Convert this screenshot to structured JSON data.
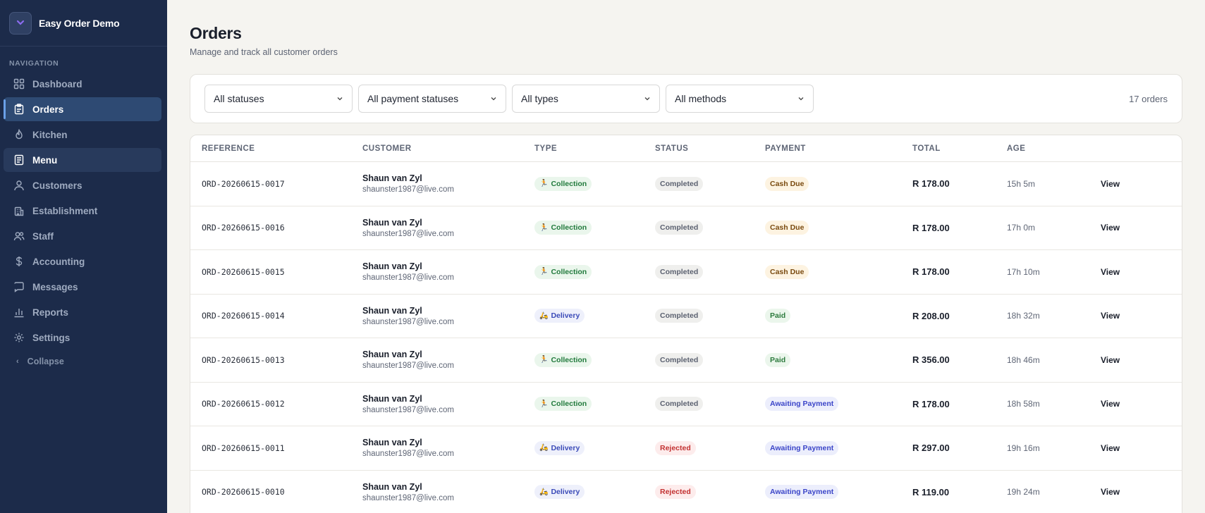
{
  "app": {
    "name": "Easy Order Demo"
  },
  "sidebar": {
    "heading": "NAVIGATION",
    "items": [
      {
        "label": "Dashboard",
        "icon": "dashboard-icon"
      },
      {
        "label": "Orders",
        "icon": "clipboard-icon"
      },
      {
        "label": "Kitchen",
        "icon": "flame-icon"
      },
      {
        "label": "Menu",
        "icon": "book-icon"
      },
      {
        "label": "Customers",
        "icon": "user-icon"
      },
      {
        "label": "Establishment",
        "icon": "building-icon"
      },
      {
        "label": "Staff",
        "icon": "users-icon"
      },
      {
        "label": "Accounting",
        "icon": "dollar-icon"
      },
      {
        "label": "Messages",
        "icon": "message-icon"
      },
      {
        "label": "Reports",
        "icon": "bar-chart-icon"
      },
      {
        "label": "Settings",
        "icon": "gear-icon"
      }
    ],
    "active": "Orders",
    "collapse_label": "Collapse"
  },
  "page": {
    "title": "Orders",
    "subtitle": "Manage and track all customer orders"
  },
  "filters": {
    "status": "All statuses",
    "payment_status": "All payment statuses",
    "type": "All types",
    "method": "All methods",
    "count_label": "17 orders"
  },
  "table": {
    "headers": [
      "REFERENCE",
      "CUSTOMER",
      "TYPE",
      "STATUS",
      "PAYMENT",
      "TOTAL",
      "AGE",
      ""
    ],
    "action_label": "View",
    "rows": [
      {
        "reference": "ORD-20260615-0017",
        "customer": "Shaun van Zyl",
        "email": "shaunster1987@live.com",
        "type": "Collection",
        "status": "Completed",
        "payment": "Cash Due",
        "total": "R 178.00",
        "age": "15h 5m"
      },
      {
        "reference": "ORD-20260615-0016",
        "customer": "Shaun van Zyl",
        "email": "shaunster1987@live.com",
        "type": "Collection",
        "status": "Completed",
        "payment": "Cash Due",
        "total": "R 178.00",
        "age": "17h 0m"
      },
      {
        "reference": "ORD-20260615-0015",
        "customer": "Shaun van Zyl",
        "email": "shaunster1987@live.com",
        "type": "Collection",
        "status": "Completed",
        "payment": "Cash Due",
        "total": "R 178.00",
        "age": "17h 10m"
      },
      {
        "reference": "ORD-20260615-0014",
        "customer": "Shaun van Zyl",
        "email": "shaunster1987@live.com",
        "type": "Delivery",
        "status": "Completed",
        "payment": "Paid",
        "total": "R 208.00",
        "age": "18h 32m"
      },
      {
        "reference": "ORD-20260615-0013",
        "customer": "Shaun van Zyl",
        "email": "shaunster1987@live.com",
        "type": "Collection",
        "status": "Completed",
        "payment": "Paid",
        "total": "R 356.00",
        "age": "18h 46m"
      },
      {
        "reference": "ORD-20260615-0012",
        "customer": "Shaun van Zyl",
        "email": "shaunster1987@live.com",
        "type": "Collection",
        "status": "Completed",
        "payment": "Awaiting Payment",
        "total": "R 178.00",
        "age": "18h 58m"
      },
      {
        "reference": "ORD-20260615-0011",
        "customer": "Shaun van Zyl",
        "email": "shaunster1987@live.com",
        "type": "Delivery",
        "status": "Rejected",
        "payment": "Awaiting Payment",
        "total": "R 297.00",
        "age": "19h 16m"
      },
      {
        "reference": "ORD-20260615-0010",
        "customer": "Shaun van Zyl",
        "email": "shaunster1987@live.com",
        "type": "Delivery",
        "status": "Rejected",
        "payment": "Awaiting Payment",
        "total": "R 119.00",
        "age": "19h 24m"
      }
    ]
  },
  "colors": {
    "sidebar_bg": "#1c2b4a",
    "active_item": "#2e4a73",
    "page_bg": "#f5f4f0"
  }
}
